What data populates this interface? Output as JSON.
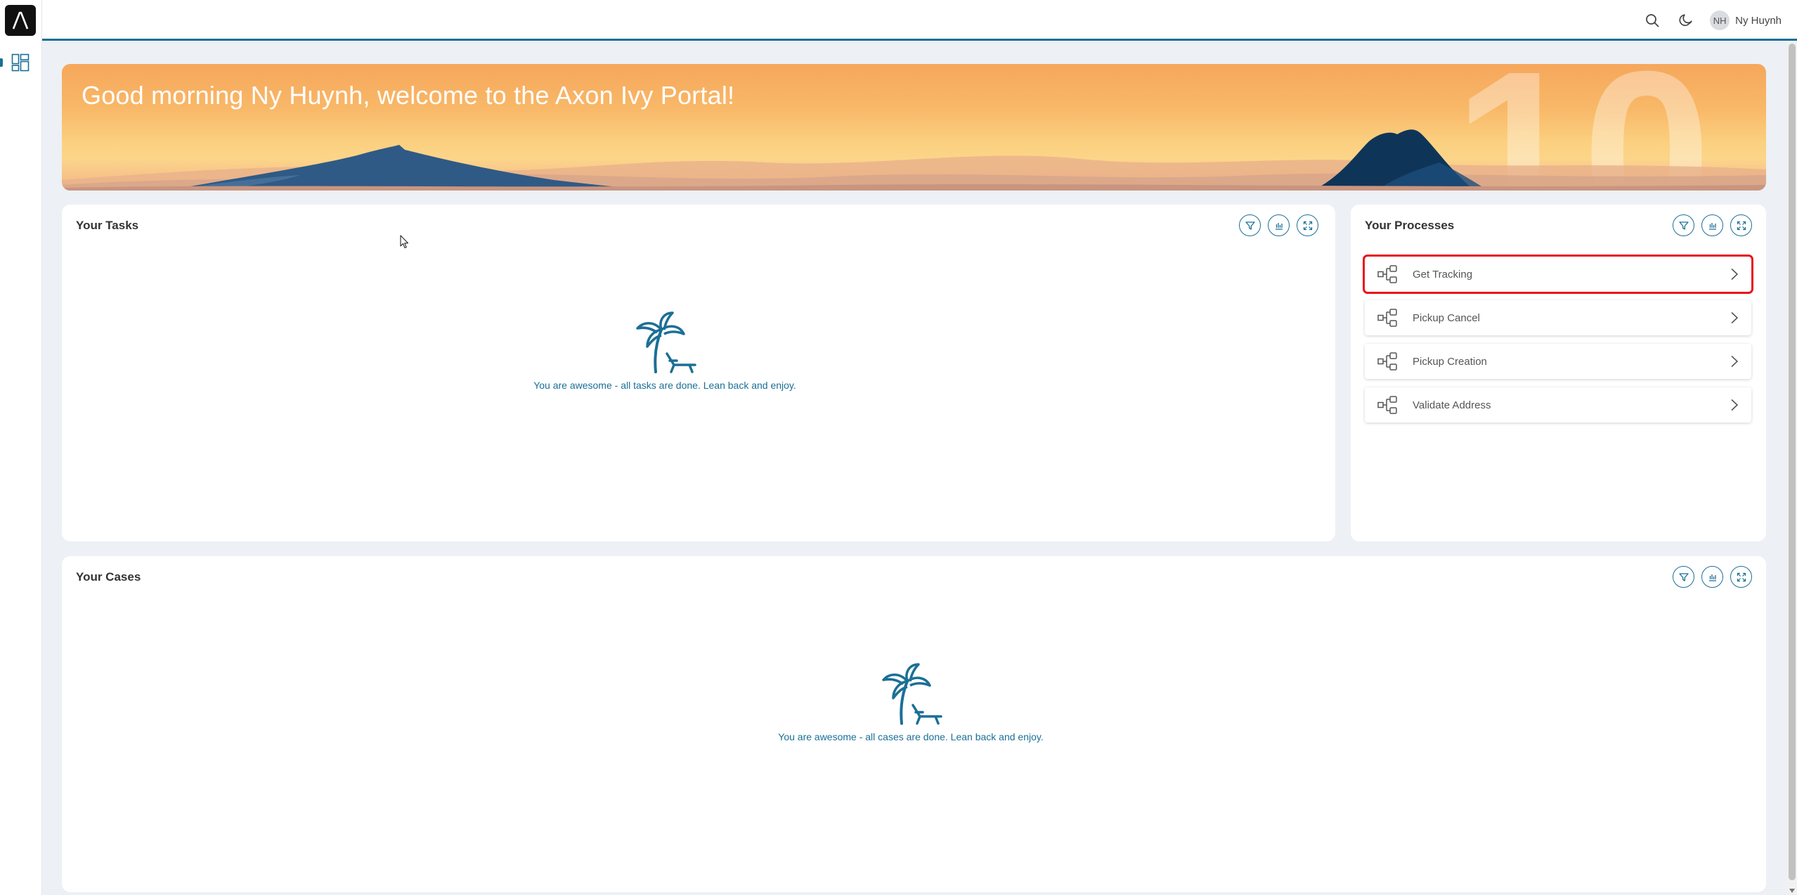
{
  "app": {
    "logo_icon": "axon-ivy-lambda-icon",
    "nav_dashboard_icon": "dashboard-icon"
  },
  "topbar": {
    "search_icon": "search-icon",
    "theme_icon": "moon-icon",
    "user_initials": "NH",
    "user_name": "Ny Huynh"
  },
  "banner": {
    "greeting": "Good morning Ny Huynh, welcome to the Axon Ivy Portal!",
    "watermark": "10"
  },
  "tasks": {
    "title": "Your Tasks",
    "empty_text": "You are awesome - all tasks are done. Lean back and enjoy."
  },
  "processes": {
    "title": "Your Processes",
    "items": [
      {
        "label": "Get Tracking",
        "highlighted": true
      },
      {
        "label": "Pickup Cancel"
      },
      {
        "label": "Pickup Creation"
      },
      {
        "label": "Validate Address"
      }
    ]
  },
  "cases": {
    "title": "Your Cases",
    "empty_text": "You are awesome - all cases are done. Lean back and enjoy."
  },
  "colors": {
    "accent": "#1b6f96",
    "highlight": "#e8121d"
  }
}
